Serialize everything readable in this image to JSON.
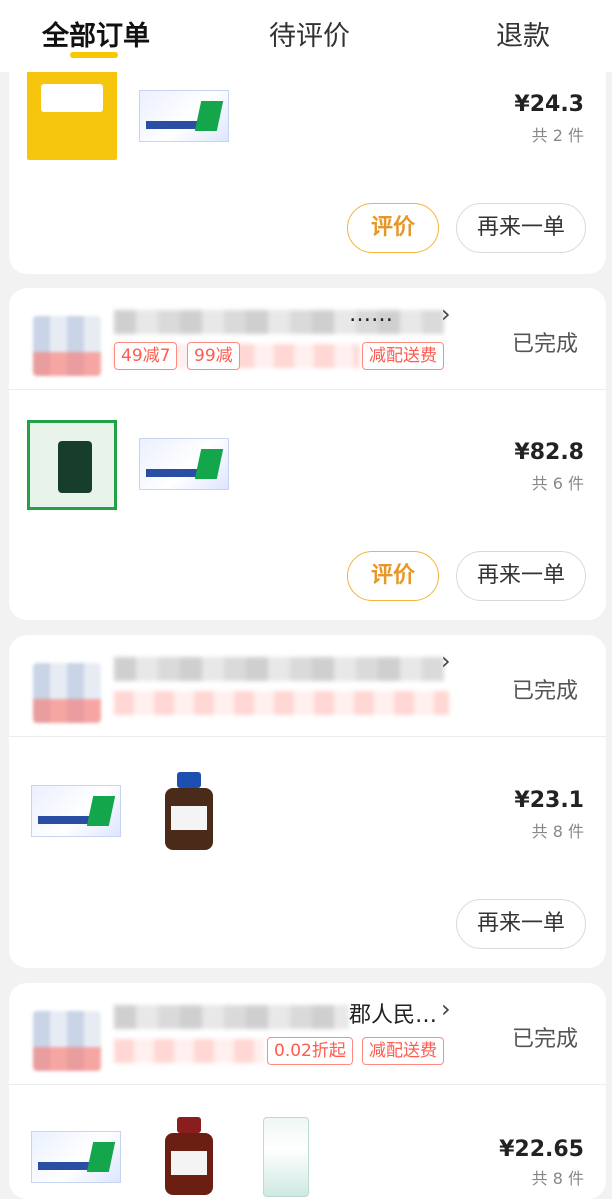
{
  "tabs": [
    {
      "label": "全部订单"
    },
    {
      "label": "待评价"
    },
    {
      "label": "退款"
    }
  ],
  "orders": [
    {
      "price": "¥24.3",
      "count": "共 2 件",
      "review_label": "评价",
      "reorder_label": "再来一单"
    },
    {
      "store_name": "……",
      "status": "已完成",
      "coupons": [
        "49减7",
        "99减",
        "减配送费"
      ],
      "price": "¥82.8",
      "count": "共 6 件",
      "review_label": "评价",
      "reorder_label": "再来一单"
    },
    {
      "status": "已完成",
      "price": "¥23.1",
      "count": "共 8 件",
      "reorder_label": "再来一单"
    },
    {
      "store_name": "郡人民…",
      "status": "已完成",
      "coupons": [
        "0.02折起",
        "减配送费"
      ],
      "price": "¥22.65",
      "count": "共 8 件"
    }
  ],
  "colors": {
    "accent_yellow": "#f7c800",
    "review_orange": "#e7962a",
    "coupon_red": "#ff5a4e"
  }
}
